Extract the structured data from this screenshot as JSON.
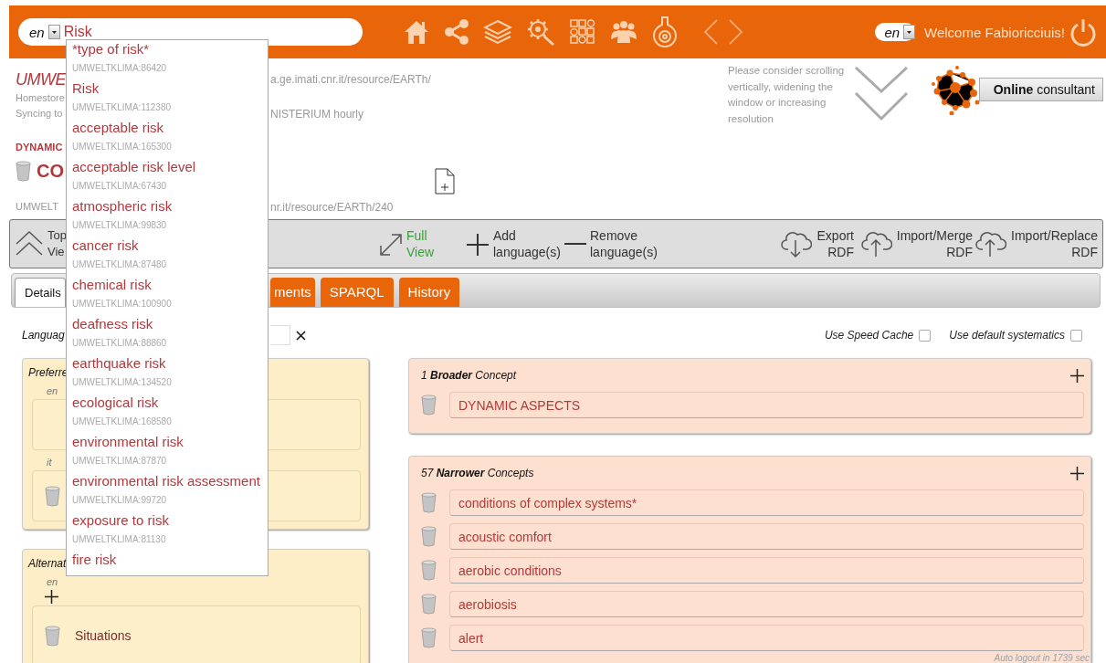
{
  "header": {
    "search": {
      "language": "en",
      "value": "Risk"
    },
    "language": "en",
    "welcome": "Welcome Fabioricciuis!"
  },
  "suggestions": [
    {
      "label": "*type of risk*",
      "code": "UMWELTKLIMA:86420"
    },
    {
      "label": "Risk",
      "code": "UMWELTKLIMA:112380"
    },
    {
      "label": "acceptable risk",
      "code": "UMWELTKLIMA:165300"
    },
    {
      "label": "acceptable risk level",
      "code": "UMWELTKLIMA:67430"
    },
    {
      "label": "atmospheric risk",
      "code": "UMWELTKLIMA:99830"
    },
    {
      "label": "cancer risk",
      "code": "UMWELTKLIMA:87480"
    },
    {
      "label": "chemical risk",
      "code": "UMWELTKLIMA:100900"
    },
    {
      "label": "deafness risk",
      "code": "UMWELTKLIMA:88860"
    },
    {
      "label": "earthquake risk",
      "code": "UMWELTKLIMA:134520"
    },
    {
      "label": "ecological risk",
      "code": "UMWELTKLIMA:168580"
    },
    {
      "label": "environmental risk",
      "code": "UMWELTKLIMA:87870"
    },
    {
      "label": "environmental risk assessment",
      "code": "UMWELTKLIMA:99720"
    },
    {
      "label": "exposure to risk",
      "code": "UMWELTKLIMA:81130"
    },
    {
      "label": "fire risk"
    }
  ],
  "info": {
    "title": "UMWE",
    "uri_tail": "a.ge.imati.cnr.it/resource/EARTh/",
    "homestore": "Homestore",
    "syncing": "Syncing to",
    "sync_tail": "NISTERIUM hourly",
    "parent": "DYNAMIC",
    "concept": "CO",
    "concept_id": "UMWELT",
    "concept_uri_tail": "nr.it/resource/EARTh/240"
  },
  "hint": "Please consider scrolling vertically, widening the window or increasing resolution",
  "consultant": "**Online** consultant",
  "toolbar": [
    {
      "kind": "collapse",
      "label": "Top Vie"
    },
    {
      "kind": "full",
      "label": "Full View"
    },
    {
      "kind": "add",
      "label": "Add language(s)"
    },
    {
      "kind": "remove",
      "label": "Remove language(s)"
    },
    {
      "kind": "export",
      "label": "Export RDF"
    },
    {
      "kind": "import",
      "label": "Import/Merge RDF"
    },
    {
      "kind": "import",
      "label": "Import/Replace RDF"
    }
  ],
  "tabs": [
    {
      "label": "Details",
      "selected": true
    },
    {
      "label": "ments",
      "selected": false
    },
    {
      "label": "SPARQL",
      "selected": false
    },
    {
      "label": "History",
      "selected": false
    }
  ],
  "language_filter": {
    "label": "Languag"
  },
  "options": [
    {
      "label": "Use Speed Cache",
      "checked": false
    },
    {
      "label": "Use default systematics",
      "checked": false
    }
  ],
  "label_panels": [
    {
      "title": "Preferre",
      "can_add": false,
      "entries": [
        {
          "lang": "en",
          "deletable": false
        },
        {
          "lang": "it",
          "deletable": true
        }
      ]
    },
    {
      "title": "Alternat",
      "can_add": true,
      "entries": [
        {
          "lang": "en",
          "deletable": true,
          "value": "Situations"
        }
      ]
    }
  ],
  "relations": [
    {
      "title": "1 **Broader** Concept",
      "items": [
        "DYNAMIC ASPECTS"
      ]
    },
    {
      "title": "57 **Narrower** Concepts",
      "items": [
        "conditions of complex systems*",
        "acoustic comfort",
        "aerobic conditions",
        "aerobiosis",
        "alert"
      ]
    }
  ],
  "auto_logout": "Auto logout in 1739 sec"
}
